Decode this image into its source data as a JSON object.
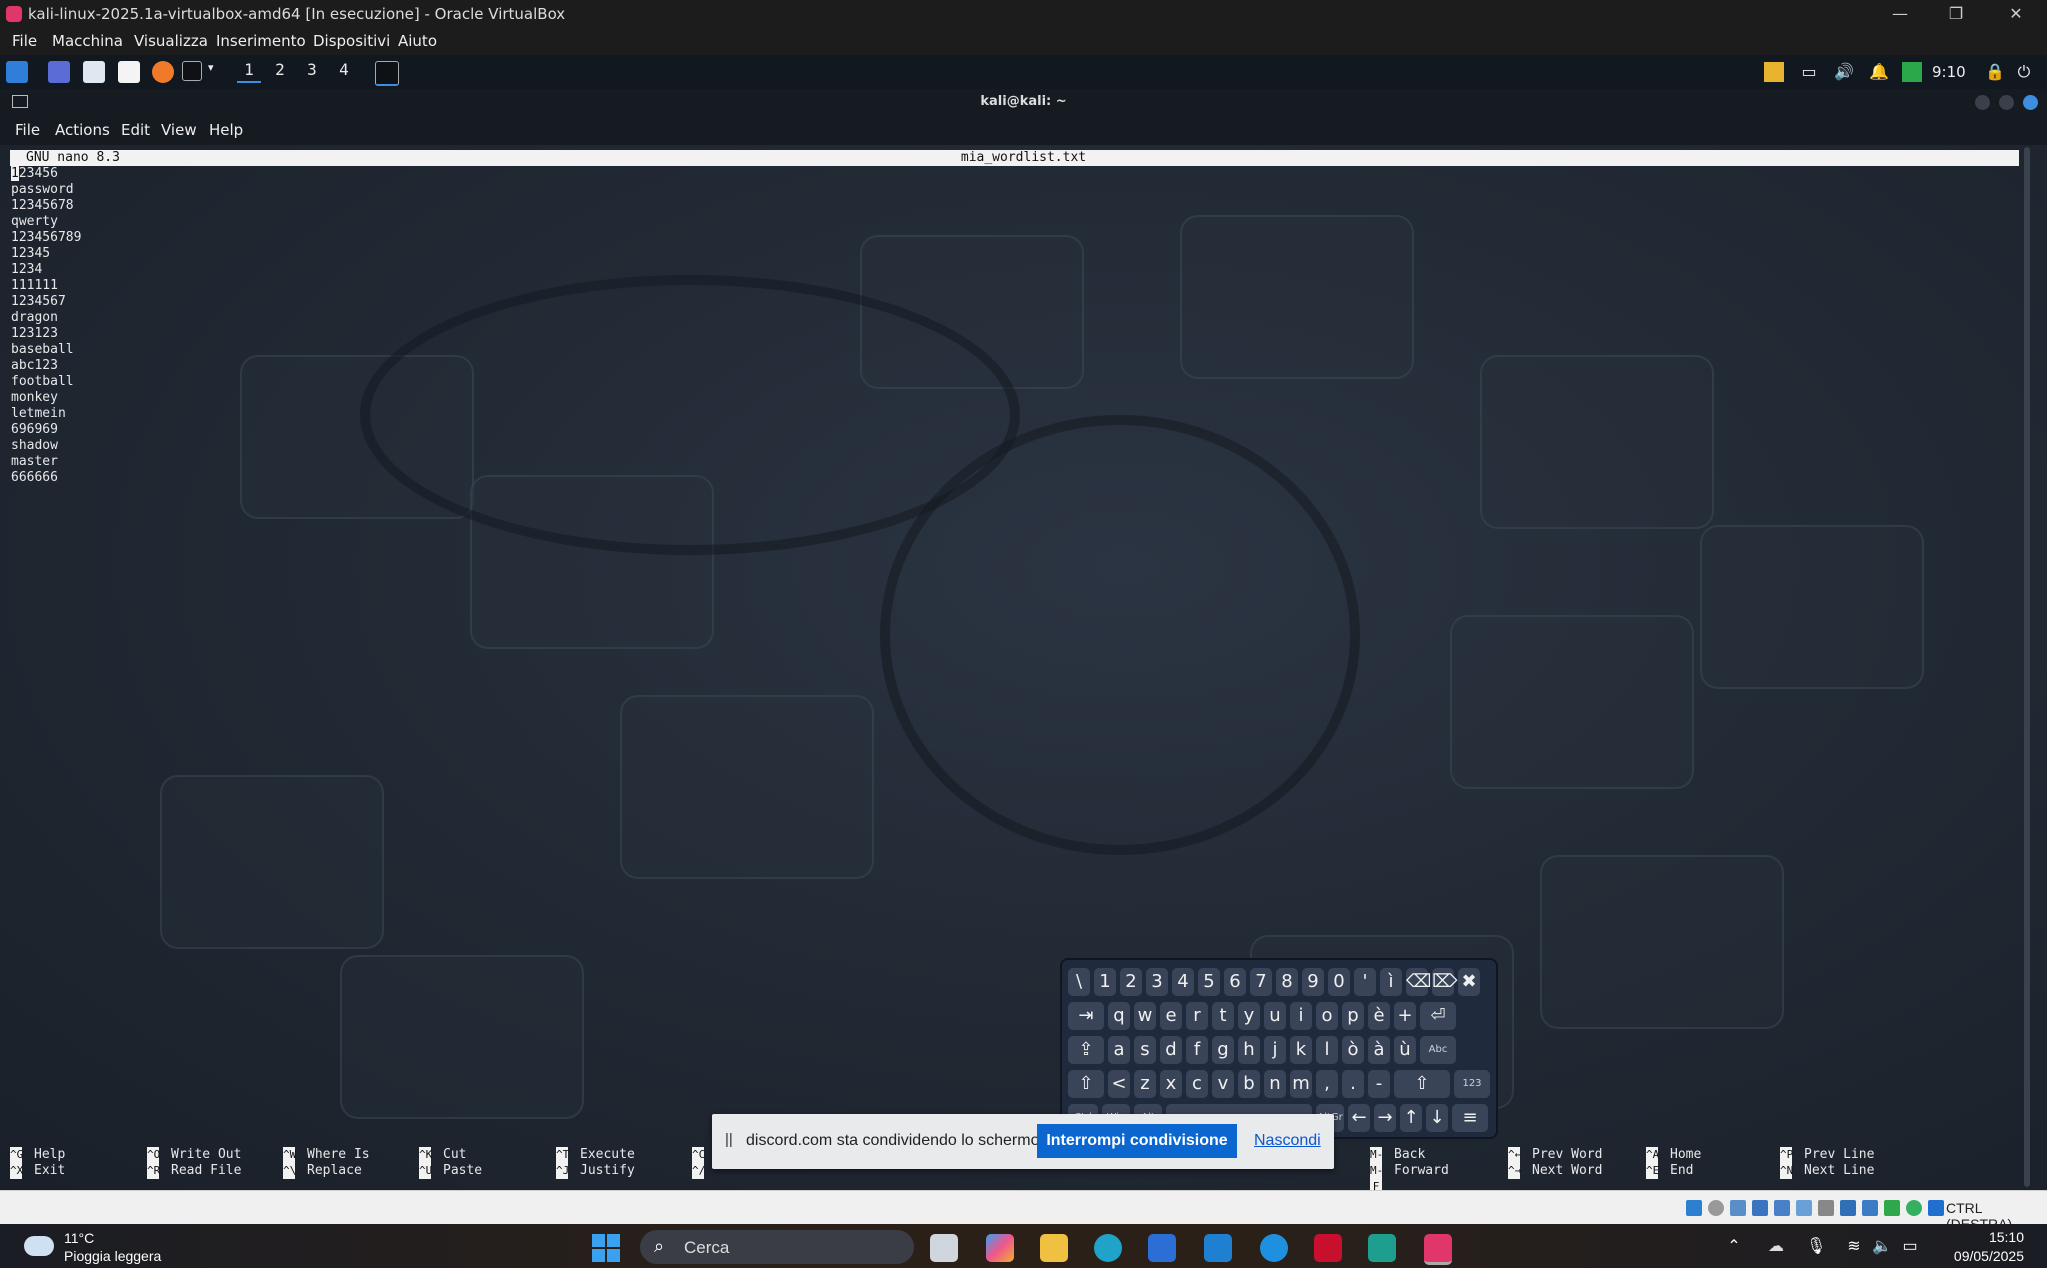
{
  "vbox": {
    "title": "kali-linux-2025.1a-virtualbox-amd64 [In esecuzione] - Oracle VirtualBox",
    "menu": [
      "File",
      "Macchina",
      "Visualizza",
      "Inserimento",
      "Dispositivi",
      "Aiuto"
    ],
    "window_controls": [
      "—",
      "❐",
      "✕"
    ],
    "host_key": "CTRL (DESTRA)"
  },
  "kali_panel": {
    "workspaces": [
      "1",
      "2",
      "3",
      "4"
    ],
    "clock": "9:10"
  },
  "terminal": {
    "title": "kali@kali: ~",
    "menu": [
      "File",
      "Actions",
      "Edit",
      "View",
      "Help"
    ]
  },
  "nano": {
    "version": "GNU nano 8.3",
    "filename": "mia_wordlist.txt",
    "lines": [
      "123456",
      "password",
      "12345678",
      "qwerty",
      "123456789",
      "12345",
      "1234",
      "111111",
      "1234567",
      "dragon",
      "123123",
      "baseball",
      "abc123",
      "football",
      "monkey",
      "letmein",
      "696969",
      "shadow",
      "master",
      "666666"
    ],
    "shortcuts": [
      {
        "k1": "^G",
        "l1": "Help",
        "k2": "^X",
        "l2": "Exit"
      },
      {
        "k1": "^O",
        "l1": "Write Out",
        "k2": "^R",
        "l2": "Read File"
      },
      {
        "k1": "^W",
        "l1": "Where Is",
        "k2": "^\\",
        "l2": "Replace"
      },
      {
        "k1": "^K",
        "l1": "Cut",
        "k2": "^U",
        "l2": "Paste"
      },
      {
        "k1": "^T",
        "l1": "Execute",
        "k2": "^J",
        "l2": "Justify"
      },
      {
        "k1": "^C",
        "l1": "",
        "k2": "^/",
        "l2": ""
      },
      {
        "k1": "M-B",
        "l1": "Back",
        "k2": "M-F",
        "l2": "Forward"
      },
      {
        "k1": "^←",
        "l1": "Prev Word",
        "k2": "^→",
        "l2": "Next Word"
      },
      {
        "k1": "^A",
        "l1": "Home",
        "k2": "^E",
        "l2": "End"
      },
      {
        "k1": "^P",
        "l1": "Prev Line",
        "k2": "^N",
        "l2": "Next Line"
      }
    ]
  },
  "share_bar": {
    "pause": "||",
    "message": "discord.com sta condividendo lo schermo.",
    "stop_label": "Interrompi condivisione",
    "hide_label": "Nascondi"
  },
  "osk": {
    "row1": [
      "\\",
      "1",
      "2",
      "3",
      "4",
      "5",
      "6",
      "7",
      "8",
      "9",
      "0",
      "'",
      "ì",
      "⌫",
      "⌦",
      "✖"
    ],
    "row2": [
      "⇥",
      "q",
      "w",
      "e",
      "r",
      "t",
      "y",
      "u",
      "i",
      "o",
      "p",
      "è",
      "+",
      "⏎"
    ],
    "row3": [
      "⇪",
      "a",
      "s",
      "d",
      "f",
      "g",
      "h",
      "j",
      "k",
      "l",
      "ò",
      "à",
      "ù",
      "Abc"
    ],
    "row4": [
      "⇧",
      "<",
      "z",
      "x",
      "c",
      "v",
      "b",
      "n",
      "m",
      ",",
      ".",
      "-",
      "⇧",
      "123"
    ],
    "row5": [
      "Ctrl",
      "Win",
      "Alt",
      "",
      "AltGr",
      "←",
      "→",
      "↑",
      "↓",
      "≡"
    ]
  },
  "taskbar": {
    "temperature": "11°C",
    "weather": "Pioggia leggera",
    "search_placeholder": "Cerca",
    "time": "15:10",
    "date": "09/05/2025"
  }
}
